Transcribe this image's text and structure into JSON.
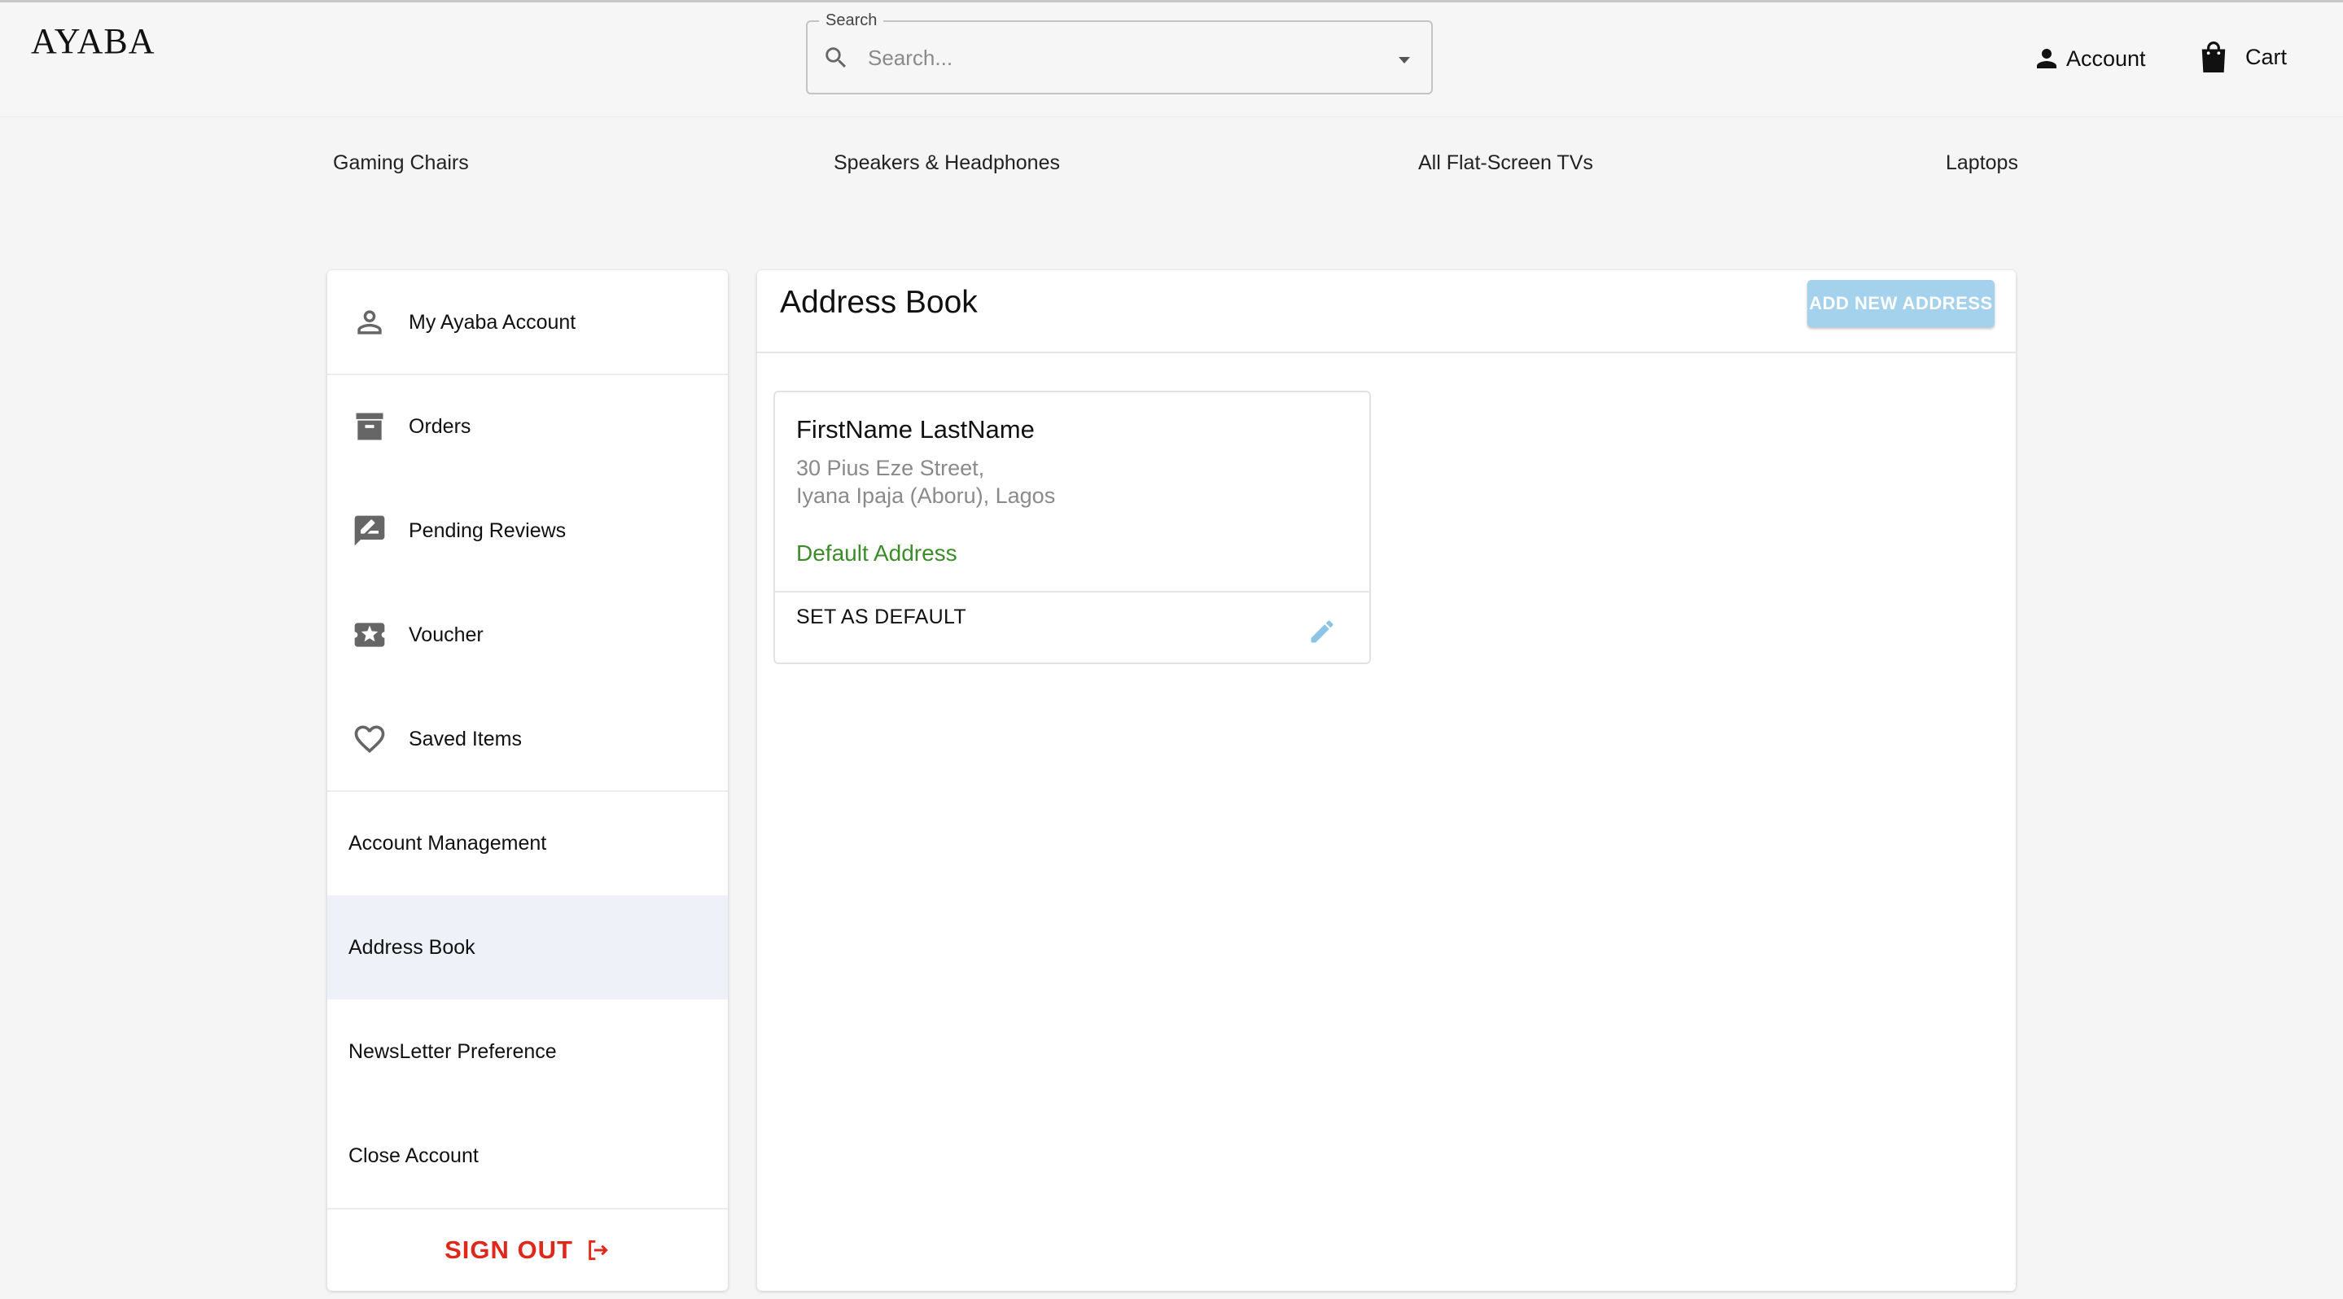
{
  "header": {
    "logo": "AYABA",
    "search": {
      "label": "Search",
      "placeholder": "Search...",
      "value": ""
    },
    "account_label": "Account",
    "cart_label": "Cart"
  },
  "categories": [
    "Gaming Chairs",
    "Speakers & Headphones",
    "All Flat-Screen TVs",
    "Laptops"
  ],
  "sidebar": {
    "items": [
      {
        "label": "My Ayaba Account",
        "icon": "person-outline-icon"
      },
      {
        "label": "Orders",
        "icon": "archive-box-icon"
      },
      {
        "label": "Pending Reviews",
        "icon": "rate-review-icon"
      },
      {
        "label": "Voucher",
        "icon": "ticket-star-icon"
      },
      {
        "label": "Saved Items",
        "icon": "heart-outline-icon"
      },
      {
        "label": "Account Management"
      },
      {
        "label": "Address Book",
        "active": true
      },
      {
        "label": "NewsLetter Preference"
      },
      {
        "label": "Close Account"
      }
    ],
    "sign_out": "SIGN OUT"
  },
  "main": {
    "title": "Address Book",
    "add_button": "ADD NEW ADDRESS",
    "address_card": {
      "name": "FirstName LastName",
      "line1": "30 Pius Eze Street,",
      "line2": "Iyana Ipaja (Aboru), Lagos",
      "default_label": "Default Address",
      "set_default": "SET AS DEFAULT"
    }
  },
  "colors": {
    "accent_button": "#a4d1ec",
    "sign_out": "#e0271b",
    "default_green": "#3c8c2a",
    "active_bg": "#eef2f8"
  }
}
